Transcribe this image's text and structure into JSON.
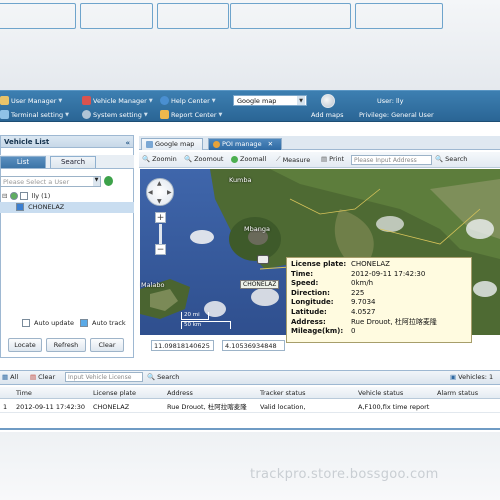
{
  "toolbar": {
    "user_manager": "User Manager",
    "vehicle_manager": "Vehicle Manager",
    "terminal_setting": "Terminal setting",
    "system_setting": "System setting",
    "help_center": "Help Center",
    "report_center": "Report Center",
    "map_select": "Google map",
    "add_maps": "Add maps",
    "user": "User: lly",
    "privilege": "Privilege: General User"
  },
  "vehicle_list": {
    "title": "Vehicle List",
    "tab_list": "List",
    "tab_search": "Search",
    "search_placeholder": "Please Select a User",
    "tree_root": "lly (1)",
    "tree_vehicle": "CHONELAZ",
    "auto_update": "Auto update",
    "auto_track": "Auto track",
    "locate": "Locate",
    "refresh": "Refresh",
    "clear": "Clear"
  },
  "map_tabs": {
    "google": "Google map",
    "poi": "POI manage"
  },
  "map_toolbar": {
    "zoomin": "Zoomin",
    "zoomout": "Zoomout",
    "zoomall": "Zoomall",
    "measure": "Measure",
    "print": "Print",
    "address_placeholder": "Please Input Address",
    "search": "Search"
  },
  "map": {
    "scale_mi": "20 mi",
    "scale_km": "50 km",
    "place_kumba": "Kumba",
    "place_mbanga": "Mbanga",
    "place_malabo": "Malabo",
    "marker_label": "CHONELAZ",
    "coord_lat": "11.09818140625",
    "coord_lng": "4.10536934848",
    "info": [
      {
        "k": "License plate:",
        "v": "CHONELAZ"
      },
      {
        "k": "Time:",
        "v": "2012-09-11 17:42:30"
      },
      {
        "k": "Speed:",
        "v": "0km/h"
      },
      {
        "k": "Direction:",
        "v": "225"
      },
      {
        "k": "Longitude:",
        "v": "9.7034"
      },
      {
        "k": "Latitude:",
        "v": "4.0527"
      },
      {
        "k": "Address:",
        "v": "Rue Drouot, 杜阿拉喀麦隆"
      },
      {
        "k": "Mileage(km):",
        "v": "0"
      }
    ]
  },
  "bottom": {
    "all": "All",
    "clear": "Clear",
    "input_placeholder": "Input Vehicle License",
    "search": "Search",
    "vehicles": "Vehicles: 1",
    "columns": [
      "Time",
      "License plate",
      "Address",
      "Tracker status",
      "Vehicle status",
      "Alarm status"
    ],
    "rows": [
      {
        "index": "1",
        "time": "2012-09-11 17:42:30",
        "plate": "CHONELAZ",
        "address": "Rue Drouot, 杜阿拉喀麦隆",
        "tracker": "Valid location,",
        "vehicle": "A,F100,fix time report",
        "alarm": ""
      }
    ]
  },
  "watermark": "trackpro.store.bossgoo.com",
  "colors": {
    "toolbar_blue": "#2f6b9b",
    "active_tab": "#3c74a7",
    "info_bg": "#fffbe0",
    "sea": "#3a5da0"
  }
}
